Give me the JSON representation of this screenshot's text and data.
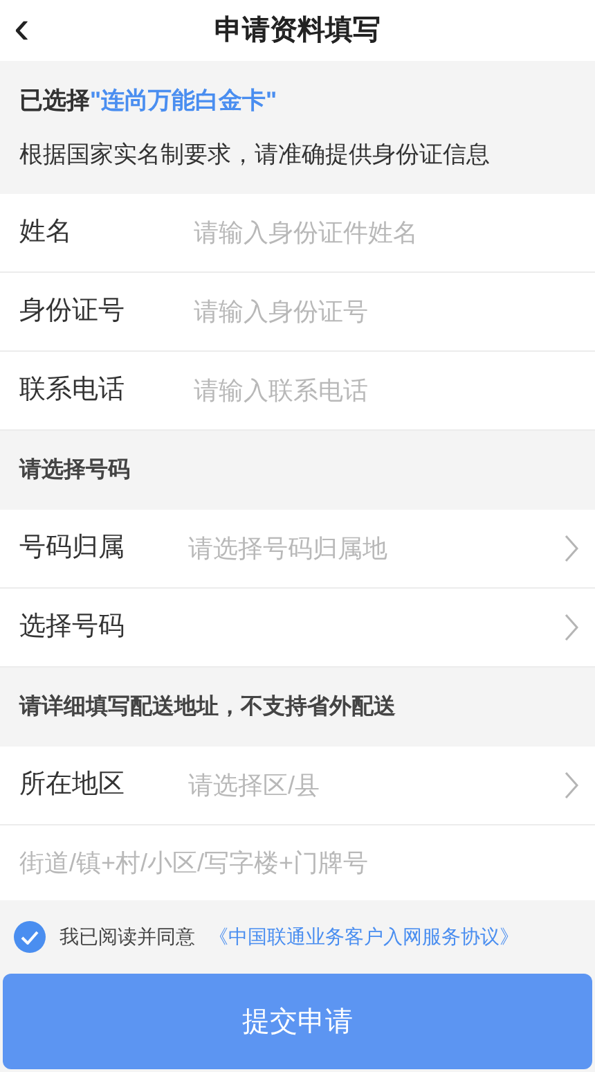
{
  "header": {
    "back": "‹",
    "title": "申请资料填写"
  },
  "intro": {
    "prefix": "已选择",
    "card": "\"连尚万能白金卡\"",
    "note": "根据国家实名制要求，请准确提供身份证信息"
  },
  "sections": [
    {
      "rows": [
        {
          "kind": "input",
          "label": "姓名",
          "placeholder": "请输入身份证件姓名"
        },
        {
          "kind": "input",
          "label": "身份证号",
          "placeholder": "请输入身份证号"
        },
        {
          "kind": "input",
          "label": "联系电话",
          "placeholder": "请输入联系电话"
        }
      ]
    },
    {
      "title": "请选择号码",
      "rows": [
        {
          "kind": "select",
          "label": "号码归属",
          "placeholder": "请选择号码归属地"
        },
        {
          "kind": "select",
          "label": "选择号码"
        }
      ]
    },
    {
      "title": "请详细填写配送地址，不支持省外配送",
      "rows": [
        {
          "kind": "select",
          "label": "所在地区",
          "placeholder": "请选择区/县"
        },
        {
          "kind": "textarea",
          "placeholder": "街道/镇+村/小区/写字楼+门牌号"
        }
      ]
    }
  ],
  "agreement": {
    "checked": true,
    "text": "我已阅读并同意",
    "link": "《中国联通业务客户入网服务协议》"
  },
  "submit": "提交申请"
}
